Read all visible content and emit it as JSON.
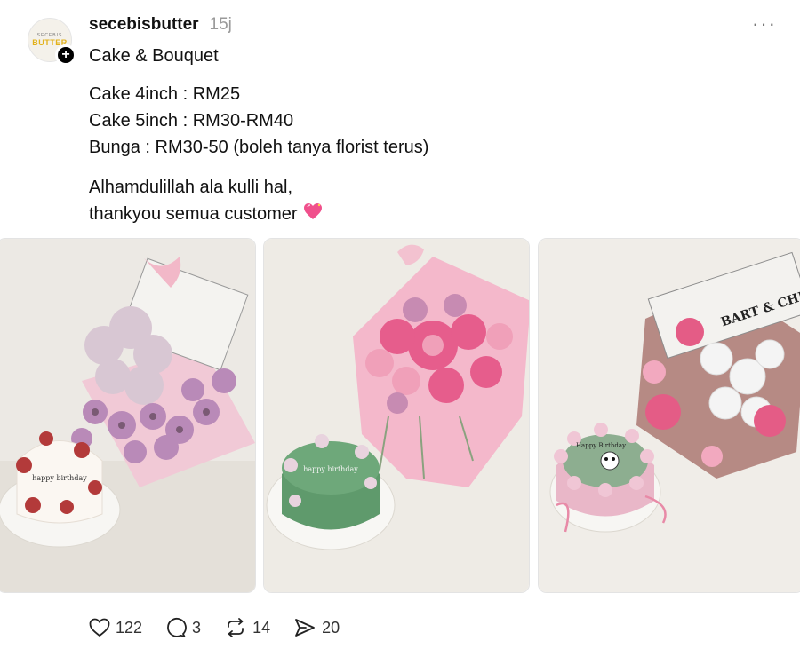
{
  "post": {
    "avatar": {
      "brand_small": "SECEBIS",
      "brand_big": "BUTTER"
    },
    "follow_badge": "+",
    "username": "secebisbutter",
    "timestamp": "15j",
    "more_label": "···",
    "caption_title": "Cake & Bouquet",
    "prices": [
      "Cake 4inch : RM25",
      "Cake 5inch : RM30-RM40",
      "Bunga : RM30-50 (boleh tanya florist terus)"
    ],
    "thanks_line_1": "Alhamdulillah ala kulli hal,",
    "thanks_line_2": "thankyou semua customer",
    "photos": [
      {
        "cake_text": "happy birthday"
      },
      {
        "cake_text": "happy birthday"
      },
      {
        "cake_text": "Happy Birthday",
        "wrap_text": "BART & CHRO"
      }
    ],
    "stats": {
      "likes": "122",
      "replies": "3",
      "reposts": "14",
      "shares": "20"
    }
  }
}
